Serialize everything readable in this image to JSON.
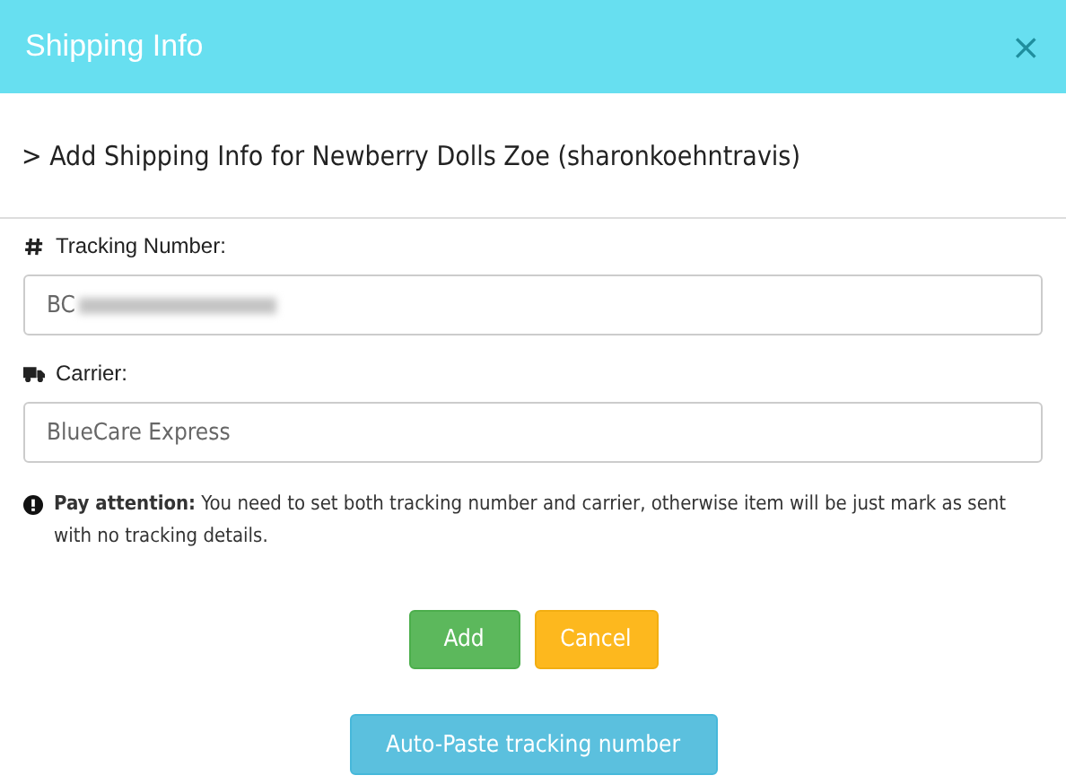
{
  "window": {
    "title": "Shipping Info",
    "close": "×"
  },
  "heading": {
    "chevron": ">",
    "text": "Add Shipping Info for Newberry Dolls Zoe (sharonkoehntravis)"
  },
  "fields": [
    {
      "kind": "tracking",
      "label": "Tracking Number:",
      "value": "BC"
    },
    {
      "kind": "carrier",
      "label": "Carrier:",
      "value": "BlueCare Express"
    }
  ],
  "notice": "**Pay attention:** You need to set both tracking number and carrier, otherwise item will be just mark as sent with no tracking details.",
  "buttons": [
    {
      "kind": "success",
      "label": "Add"
    },
    {
      "kind": "warning",
      "label": "Cancel"
    }
  ],
  "auto_paste": {
    "label": "Auto-Paste tracking number"
  }
}
